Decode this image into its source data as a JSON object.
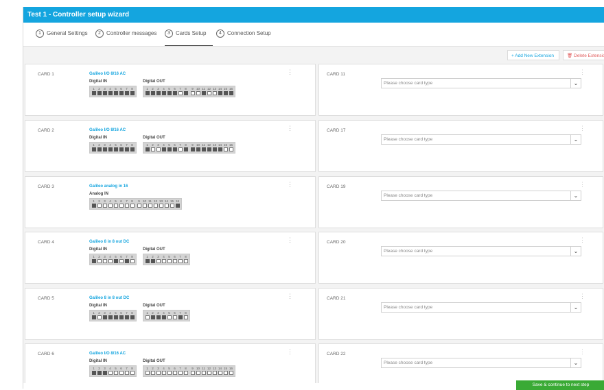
{
  "window": {
    "title": "Test 1 - Controller setup wizard"
  },
  "tabs": [
    {
      "num": "1",
      "label": "General Settings"
    },
    {
      "num": "2",
      "label": "Controller messages"
    },
    {
      "num": "3",
      "label": "Cards Setup"
    },
    {
      "num": "4",
      "label": "Connection Setup"
    }
  ],
  "toolbar": {
    "add_label": "+ Add New Extension",
    "delete_label": "🗑 Delete Extension"
  },
  "left_cards": [
    {
      "label": "CARD 1",
      "type": "Galileo I/O 8/16 AC",
      "groups": [
        {
          "title": "Digital IN",
          "pins": [
            1,
            1,
            1,
            1,
            1,
            1,
            1,
            1
          ]
        },
        {
          "title": "Digital OUT",
          "pins": [
            1,
            1,
            1,
            1,
            1,
            1,
            0,
            1,
            0,
            0,
            1,
            0,
            0,
            1,
            1,
            1
          ]
        }
      ]
    },
    {
      "label": "CARD 2",
      "type": "Galileo I/O 8/16 AC",
      "groups": [
        {
          "title": "Digital IN",
          "pins": [
            1,
            1,
            1,
            1,
            1,
            1,
            1,
            1
          ]
        },
        {
          "title": "Digital OUT",
          "pins": [
            1,
            0,
            0,
            1,
            1,
            1,
            0,
            1,
            1,
            1,
            1,
            1,
            1,
            1,
            0,
            0
          ]
        }
      ]
    },
    {
      "label": "CARD 3",
      "type": "Galileo analog in 16",
      "groups": [
        {
          "title": "Analog IN",
          "pins": [
            1,
            0,
            0,
            0,
            0,
            0,
            0,
            0,
            0,
            0,
            0,
            0,
            0,
            0,
            0,
            1
          ]
        }
      ]
    },
    {
      "label": "CARD 4",
      "type": "Galileo 8 in 8 out DC",
      "groups": [
        {
          "title": "Digital IN",
          "pins": [
            1,
            0,
            0,
            0,
            1,
            0,
            1,
            0
          ]
        },
        {
          "title": "Digital OUT",
          "pins": [
            1,
            1,
            0,
            0,
            0,
            0,
            0,
            0
          ]
        }
      ]
    },
    {
      "label": "CARD 5",
      "type": "Galileo 8 in 8 out DC",
      "groups": [
        {
          "title": "Digital IN",
          "pins": [
            1,
            0,
            1,
            1,
            1,
            1,
            1,
            1
          ]
        },
        {
          "title": "Digital OUT",
          "pins": [
            0,
            1,
            1,
            1,
            0,
            0,
            1,
            0
          ]
        }
      ]
    },
    {
      "label": "CARD 6",
      "type": "Galileo I/O 8/16 AC",
      "groups": [
        {
          "title": "Digital IN",
          "pins": [
            1,
            1,
            1,
            0,
            0,
            0,
            0,
            0
          ]
        },
        {
          "title": "Digital OUT",
          "pins": [
            0,
            0,
            0,
            0,
            0,
            0,
            0,
            0,
            0,
            0,
            0,
            0,
            0,
            0,
            0,
            0
          ]
        }
      ]
    }
  ],
  "right_cards": [
    {
      "label": "CARD 11",
      "placeholder": "Please choose card type"
    },
    {
      "label": "CARD 17",
      "placeholder": "Please choose card type"
    },
    {
      "label": "CARD 19",
      "placeholder": "Please choose card type"
    },
    {
      "label": "CARD 20",
      "placeholder": "Please choose card type"
    },
    {
      "label": "CARD 21",
      "placeholder": "Please choose card type"
    },
    {
      "label": "CARD 22",
      "placeholder": "Please choose card type"
    }
  ],
  "footer": {
    "save_label": "Save & continue to next step"
  },
  "colors": {
    "accent": "#14a5df",
    "save": "#3aaa35",
    "delete": "#e05a5a"
  }
}
